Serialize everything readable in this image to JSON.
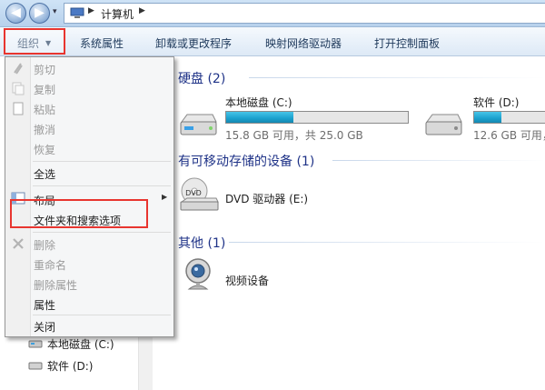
{
  "address_bar": {
    "breadcrumb": [
      "计算机"
    ],
    "sep": "▶",
    "history_arrow": "▾",
    "back_glyph": "◀",
    "forward_glyph": "▶"
  },
  "command_bar": {
    "organize": "组织",
    "organize_arrow": "▼",
    "system_properties": "系统属性",
    "uninstall": "卸载或更改程序",
    "map_drive": "映射网络驱动器",
    "control_panel": "打开控制面板"
  },
  "groups": {
    "hard_disks": "硬盘 (2)",
    "removable": "有可移动存储的设备 (1)",
    "other": "其他 (1)"
  },
  "drives": [
    {
      "name": "本地磁盘 (C:)",
      "size": "15.8 GB 可用，共 25.0 GB",
      "used_fraction": 0.37
    },
    {
      "name": "软件 (D:)",
      "size": "12.6 GB 可用，共",
      "used_fraction": 0.38
    }
  ],
  "dvd": {
    "name": "DVD 驱动器 (E:)",
    "icon_text": "DVD"
  },
  "video": {
    "name": "视频设备"
  },
  "menu": {
    "cut": "剪切",
    "copy": "复制",
    "paste": "粘贴",
    "undo": "撤消",
    "redo": "恢复",
    "select_all": "全选",
    "layout": "布局",
    "layout_arrow": "▶",
    "folder_options": "文件夹和搜索选项",
    "delete": "删除",
    "rename": "重命名",
    "remove_properties": "删除属性",
    "properties": "属性",
    "close": "关闭"
  },
  "nav_pane": {
    "items": [
      "本地磁盘 (C:)",
      "软件 (D:)"
    ]
  },
  "colors": {
    "highlight": "#e8352f",
    "group_header": "#1e3287",
    "bar_fill": "#1ba1cd"
  }
}
